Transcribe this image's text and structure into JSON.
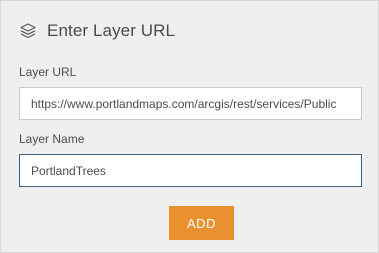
{
  "header": {
    "icon": "layers-icon",
    "title": "Enter Layer URL"
  },
  "form": {
    "layer_url_label": "Layer URL",
    "layer_url_value": "https://www.portlandmaps.com/arcgis/rest/services/Public",
    "layer_name_label": "Layer Name",
    "layer_name_value": "PortlandTrees"
  },
  "actions": {
    "add_label": "ADD"
  },
  "colors": {
    "panel_background": "#efefef",
    "add_button": "#e9912f",
    "focused_input_border": "#3b5f86"
  }
}
